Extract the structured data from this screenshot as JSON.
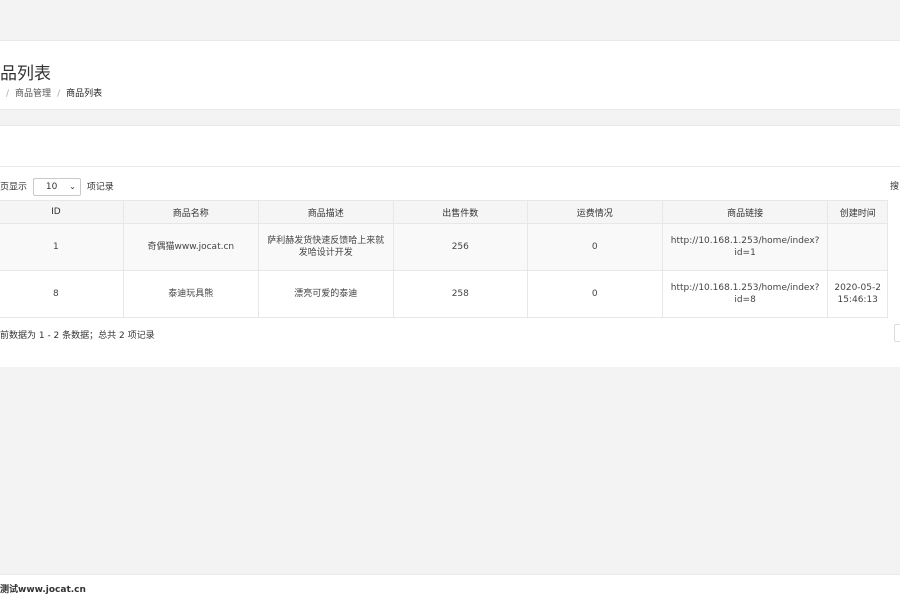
{
  "header": {
    "title": "品列表",
    "breadcrumb": {
      "lead_sep": "/",
      "item1": "商品管理",
      "sep": "/",
      "current": "商品列表"
    }
  },
  "toolbar": {
    "length_prefix": "页显示",
    "length_value": "10",
    "length_suffix": "项记录",
    "search_label": "搜"
  },
  "table": {
    "columns": [
      "ID",
      "商品名称",
      "商品描述",
      "出售件数",
      "运费情况",
      "商品链接",
      "创建时间"
    ],
    "rows": [
      {
        "id": "1",
        "name": "奇偶猫www.jocat.cn",
        "desc": "萨利赫发货快速反馈哈上来就发哈设计开发",
        "sold": "256",
        "shipping": "0",
        "link": "http://10.168.1.253/home/index?id=1",
        "created_line1": "",
        "created_line2": ""
      },
      {
        "id": "8",
        "name": "泰迪玩具熊",
        "desc": "漂亮可爱的泰迪",
        "sold": "258",
        "shipping": "0",
        "link": "http://10.168.1.253/home/index?id=8",
        "created_line1": "2020-05-2",
        "created_line2": "15:46:13"
      }
    ]
  },
  "info": {
    "text": "前数据为 1 - 2 条数据；总共 2 项记录"
  },
  "footer": {
    "text": "测试www.jocat.cn"
  }
}
